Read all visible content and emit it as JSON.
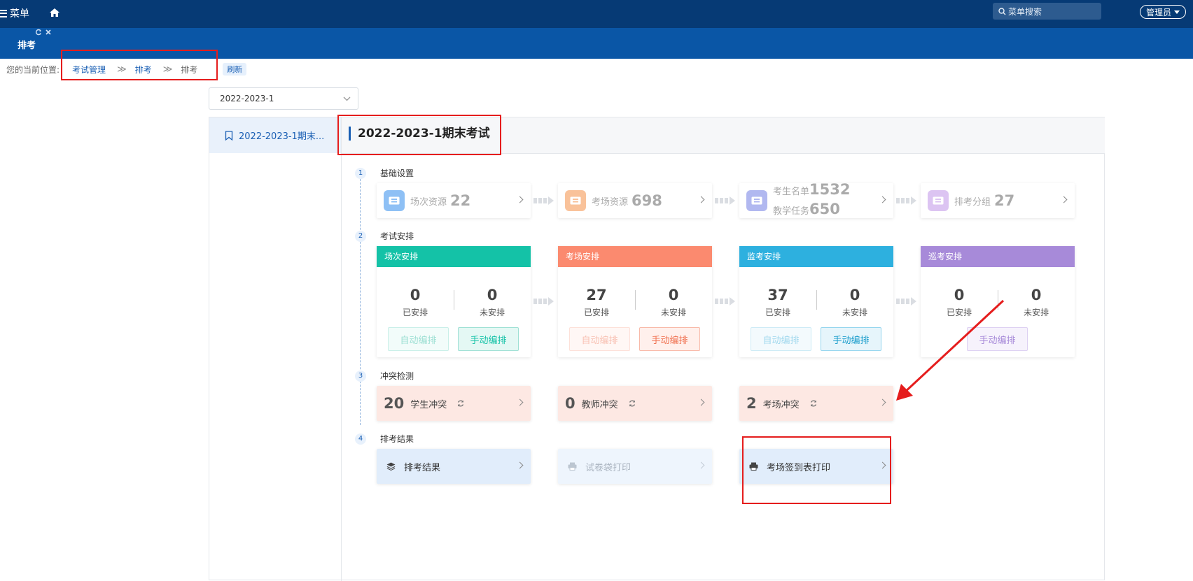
{
  "topbar": {
    "menu_label": "菜单",
    "search_placeholder": "菜单搜索",
    "user_label": "管理员"
  },
  "tabbar": {
    "active_tab": "排考"
  },
  "breadcrumb": {
    "label": "您的当前位置:",
    "items": [
      "考试管理",
      "排考",
      "排考"
    ],
    "refresh_label": "刷新"
  },
  "term_select": {
    "value": "2022-2023-1"
  },
  "sidebar": {
    "items": [
      {
        "label": "2022-2023-1期末..."
      }
    ]
  },
  "exam": {
    "title": "2022-2023-1期末考试"
  },
  "steps": [
    {
      "num": "1",
      "label": "基础设置"
    },
    {
      "num": "2",
      "label": "考试安排"
    },
    {
      "num": "3",
      "label": "冲突检测"
    },
    {
      "num": "4",
      "label": "排考结果"
    }
  ],
  "basic": [
    {
      "label": "场次资源",
      "value": "22",
      "color": "#8ec0f5"
    },
    {
      "label": "考场资源",
      "value": "698",
      "color": "#f9c29a"
    },
    {
      "label": "考生名单",
      "value": "1532",
      "label2": "教学任务",
      "value2": "650",
      "color": "#b1b8f0"
    },
    {
      "label": "排考分组",
      "value": "27",
      "color": "#dcc4f2"
    }
  ],
  "arrange": [
    {
      "title": "场次安排",
      "color": "#14c2a7",
      "done": "0",
      "todo": "0",
      "done_label": "已安排",
      "todo_label": "未安排",
      "auto": "自动编排",
      "manual": "手动编排"
    },
    {
      "title": "考场安排",
      "color": "#fb8a6f",
      "done": "27",
      "todo": "0",
      "done_label": "已安排",
      "todo_label": "未安排",
      "auto": "自动编排",
      "manual": "手动编排"
    },
    {
      "title": "监考安排",
      "color": "#2db0df",
      "done": "37",
      "todo": "0",
      "done_label": "已安排",
      "todo_label": "未安排",
      "auto": "自动编排",
      "manual": "手动编排"
    },
    {
      "title": "巡考安排",
      "color": "#a78ad9",
      "done": "0",
      "todo": "0",
      "done_label": "已安排",
      "todo_label": "未安排",
      "manual": "手动编排"
    }
  ],
  "conflicts": [
    {
      "value": "20",
      "label": "学生冲突"
    },
    {
      "value": "0",
      "label": "教师冲突"
    },
    {
      "value": "2",
      "label": "考场冲突"
    }
  ],
  "results": [
    {
      "label": "排考结果",
      "icon": "layers-icon"
    },
    {
      "label": "试卷袋打印",
      "icon": "printer-icon"
    },
    {
      "label": "考场签到表打印",
      "icon": "printer-icon"
    }
  ],
  "annotation_color": "#e51d1d"
}
